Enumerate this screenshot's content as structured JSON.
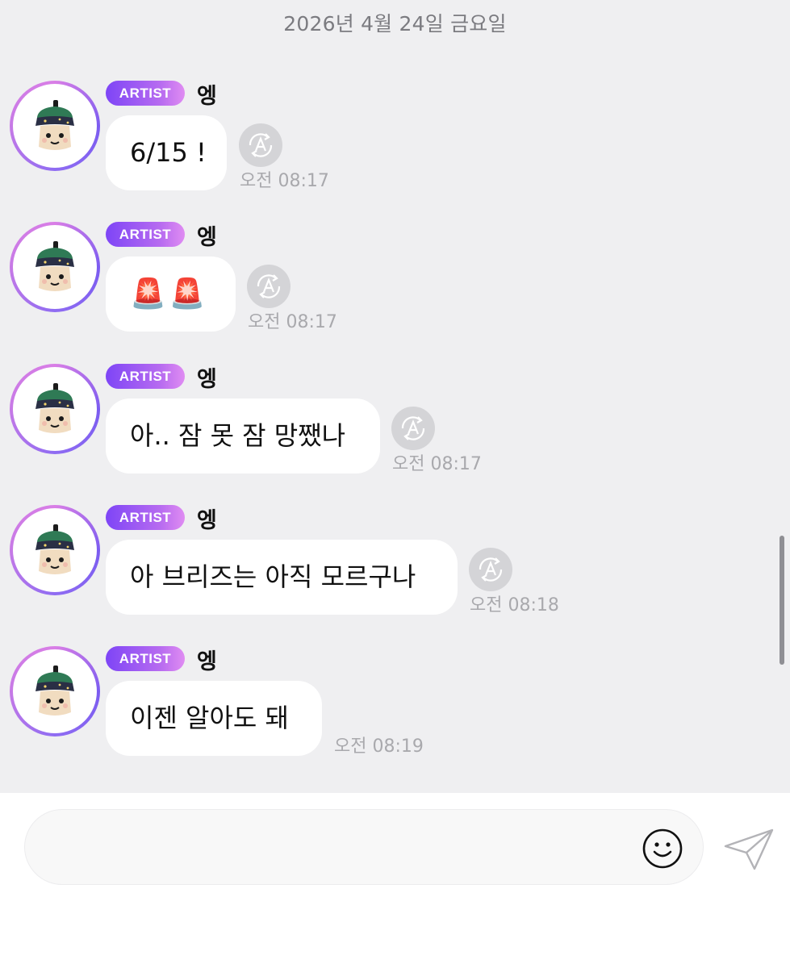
{
  "chat": {
    "date_header": "2026년 4월 24일 금요일",
    "messages": [
      {
        "badge": "ARTIST",
        "sender": "엥",
        "text": "6/15 !",
        "time": "오전 08:17",
        "has_translate": true
      },
      {
        "badge": "ARTIST",
        "sender": "엥",
        "text": "🚨🚨",
        "time": "오전 08:17",
        "has_translate": true
      },
      {
        "badge": "ARTIST",
        "sender": "엥",
        "text": "아.. 잠 못 잠 망쨌나",
        "time": "오전 08:17",
        "has_translate": true
      },
      {
        "badge": "ARTIST",
        "sender": "엥",
        "text": "아 브리즈는 아직 모르구나",
        "time": "오전 08:18",
        "has_translate": true
      },
      {
        "badge": "ARTIST",
        "sender": "엥",
        "text": "이젠 알아도 돼",
        "time": "오전 08:19",
        "has_translate": false
      }
    ]
  },
  "input": {
    "placeholder": "",
    "emoji_icon": "smiley-icon",
    "send_icon": "paper-plane-icon"
  },
  "colors": {
    "chat_background": "#efeff1",
    "badge_gradient_start": "#7e45f6",
    "badge_gradient_end": "#e08cf2",
    "timestamp": "#a9a9ad",
    "translate_button": "#d4d4d7"
  }
}
